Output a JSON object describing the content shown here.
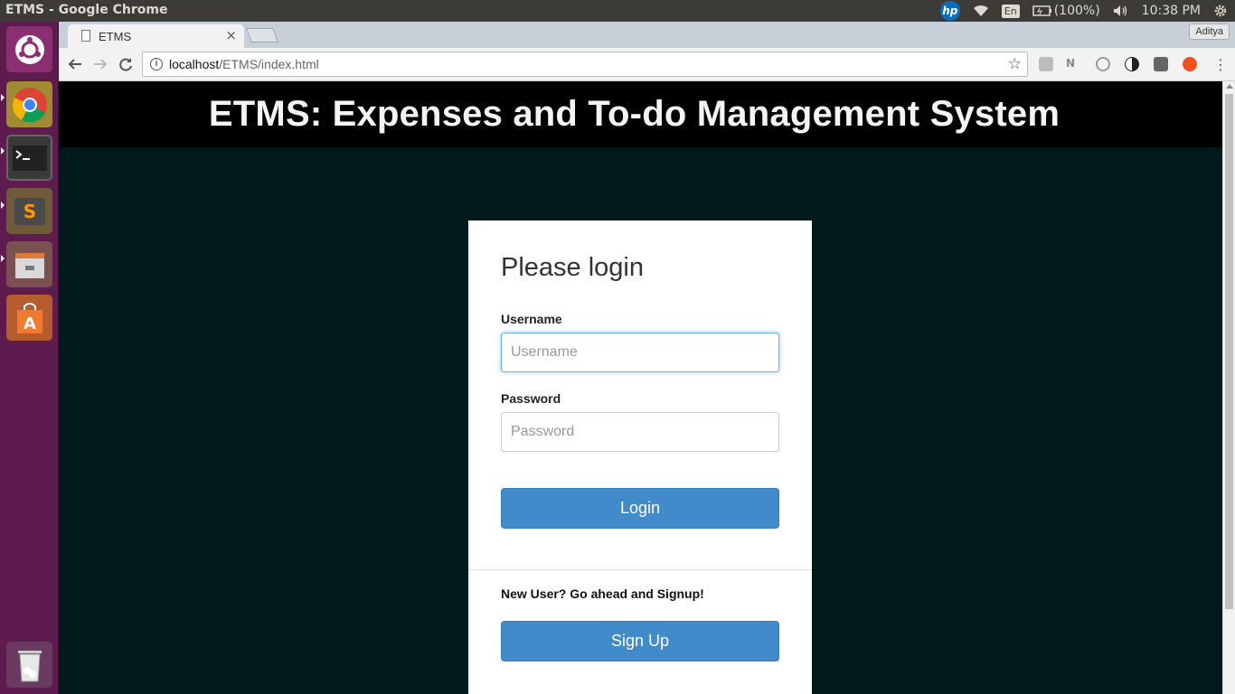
{
  "os": {
    "window_title": "ETMS - Google Chrome",
    "language": "En",
    "battery": "(100%)",
    "clock": "10:38 PM"
  },
  "browser": {
    "tab_title": "ETMS",
    "profile": "Aditya",
    "url_host": "localhost",
    "url_path": "/ETMS/index.html"
  },
  "page": {
    "header": "ETMS: Expenses and To-do Management System",
    "login": {
      "title": "Please login",
      "username_label": "Username",
      "username_placeholder": "Username",
      "password_label": "Password",
      "password_placeholder": "Password",
      "login_button": "Login",
      "signup_prompt": "New User? Go ahead and Signup!",
      "signup_button": "Sign Up"
    }
  },
  "colors": {
    "page_background": "#00191b",
    "button_primary": "#428bca",
    "launcher": "#5e1b4e"
  }
}
